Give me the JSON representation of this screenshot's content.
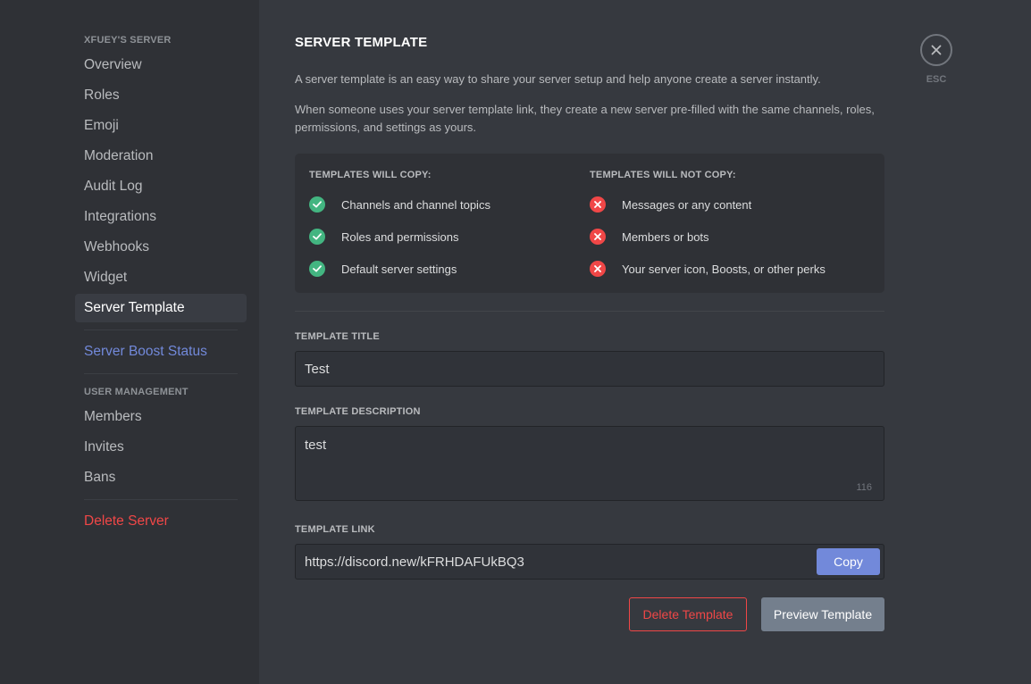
{
  "sidebar": {
    "server_header": "XFUEY'S SERVER",
    "items": [
      {
        "label": "Overview"
      },
      {
        "label": "Roles"
      },
      {
        "label": "Emoji"
      },
      {
        "label": "Moderation"
      },
      {
        "label": "Audit Log"
      },
      {
        "label": "Integrations"
      },
      {
        "label": "Webhooks"
      },
      {
        "label": "Widget"
      },
      {
        "label": "Server Template"
      }
    ],
    "active_item": "Server Template",
    "boost_label": "Server Boost Status",
    "user_mgmt_header": "USER MANAGEMENT",
    "user_items": [
      {
        "label": "Members"
      },
      {
        "label": "Invites"
      },
      {
        "label": "Bans"
      }
    ],
    "delete_label": "Delete Server"
  },
  "main": {
    "title": "SERVER TEMPLATE",
    "intro": "A server template is an easy way to share your server setup and help anyone create a server instantly.",
    "intro2": "When someone uses your server template link, they create a new server pre-filled with the same channels, roles, permissions, and settings as yours.",
    "will_copy": {
      "title": "TEMPLATES WILL COPY:",
      "items": [
        "Channels and channel topics",
        "Roles and permissions",
        "Default server settings"
      ]
    },
    "will_not_copy": {
      "title": "TEMPLATES WILL NOT COPY:",
      "items": [
        "Messages or any content",
        "Members or bots",
        "Your server icon, Boosts, or other perks"
      ]
    },
    "template_title_label": "TEMPLATE TITLE",
    "template_title_value": "Test",
    "template_desc_label": "TEMPLATE DESCRIPTION",
    "template_desc_value": "test",
    "template_desc_counter": "116",
    "template_link_label": "TEMPLATE LINK",
    "template_link_value": "https://discord.new/kFRHDAFUkBQ3",
    "copy_label": "Copy",
    "delete_template_label": "Delete Template",
    "preview_template_label": "Preview Template"
  },
  "close": {
    "esc_label": "ESC"
  },
  "colors": {
    "accent": "#7289da",
    "danger": "#f04747",
    "success": "#43b581",
    "sidebar_bg": "#2f3136",
    "main_bg": "#36393f"
  },
  "icons": {
    "check": "check-icon",
    "cross": "x-icon",
    "close": "close-icon"
  }
}
